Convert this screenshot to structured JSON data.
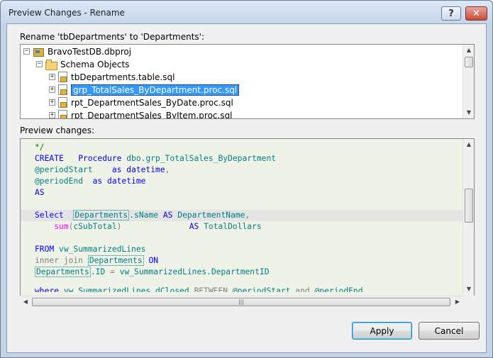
{
  "window": {
    "title": "Preview Changes - Rename",
    "help_label": "?",
    "close_label": "✕"
  },
  "rename_label": "Rename 'tbDepartments' to 'Departments':",
  "tree": {
    "items": [
      {
        "label": "BravoTestDB.dbproj",
        "expander": "−",
        "icon": "project-icon"
      },
      {
        "label": "Schema Objects",
        "expander": "−",
        "icon": "folder-icon"
      },
      {
        "label": "tbDepartments.table.sql",
        "expander": "+",
        "icon": "sql-file-icon"
      },
      {
        "label": "grp_TotalSales_ByDepartment.proc.sql",
        "expander": "+",
        "icon": "sql-file-icon",
        "selected": true
      },
      {
        "label": "rpt_DepartmentSales_ByDate.proc.sql",
        "expander": "+",
        "icon": "sql-file-icon"
      },
      {
        "label": "rpt_DepartmentSales_ByItem.proc.sql",
        "expander": "+",
        "icon": "sql-file-icon"
      }
    ]
  },
  "preview_label": "Preview changes:",
  "code": {
    "l1": "*/",
    "l2_kw": "CREATE   Procedure ",
    "l2_id": "dbo.grp_TotalSales_ByDepartment",
    "l3_id": "@periodStart    ",
    "l3_kw": "as datetime",
    "l3_p": ",",
    "l4_id": "@periodEnd  ",
    "l4_kw": "as datetime",
    "l5_kw": "AS",
    "l7_kw": "Select  ",
    "l7_ren": "Departments",
    "l7_a": ".sName ",
    "l7_as": "AS ",
    "l7_b": "DepartmentName",
    "l7_p": ",",
    "l8_indent": "    ",
    "l8_fn": "sum",
    "l8_gr1": "(",
    "l8_id": "cSubTotal",
    "l8_gr2": ")",
    "l8_pad": "              ",
    "l8_as": "AS ",
    "l8_b": "TotalDollars",
    "l10_kw": "FROM ",
    "l10_id": "vw_SummarizedLines",
    "l11_gr": "inner join ",
    "l11_ren": "Departments",
    "l11_kw": " ON",
    "l12_ren": "Departments",
    "l12_a": ".ID ",
    "l12_eq": "= ",
    "l12_b": "vw_SummarizedLines.DepartmentID",
    "l13_kw": "where ",
    "l13_a": "vw_SummarizedLines.dClosed ",
    "l13_gr": "BETWEEN ",
    "l13_b": "@periodStart ",
    "l13_and": "and ",
    "l13_c": "@periodEnd"
  },
  "buttons": {
    "apply": "Apply",
    "cancel": "Cancel"
  },
  "colors": {
    "keyword": "#0000ff",
    "identifier": "#008080",
    "function": "#ff00ff",
    "operator": "#808080",
    "selection": "#3399ff",
    "code_background": "#eff2e6"
  }
}
